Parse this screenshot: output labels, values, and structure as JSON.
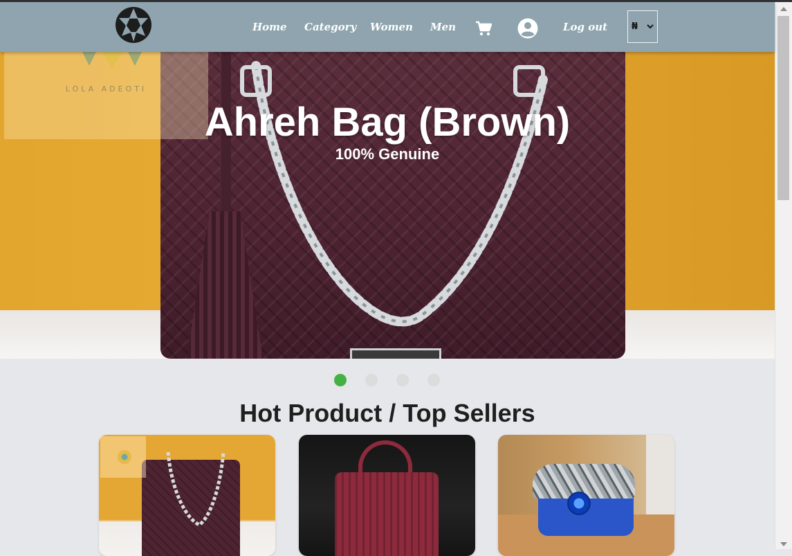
{
  "nav": {
    "links": [
      "Home",
      "Category",
      "Women",
      "Men"
    ],
    "logout": "Log out",
    "currency": "₦",
    "icons": {
      "logo": "brand-logo",
      "cart": "cart-icon",
      "account": "account-icon",
      "dropdown": "chevron-down-icon"
    }
  },
  "hero": {
    "watermark": "LOLA ADEOTI",
    "title": "Ahreh Bag (Brown)",
    "subtitle": "100% Genuine",
    "slides_count": 4,
    "active_slide": 1
  },
  "section": {
    "title": "Hot Product / Top Sellers"
  },
  "products": [
    {
      "image": "Brown woven leather bag with chain strap"
    },
    {
      "image": "Red croc-textured tote bag"
    },
    {
      "image": "Blue bag with snakeskin flap and flower ornament"
    }
  ],
  "colors": {
    "navbar": "#8fa4ae",
    "active_dot": "#45b043",
    "page_background": "#e6e7ea"
  }
}
